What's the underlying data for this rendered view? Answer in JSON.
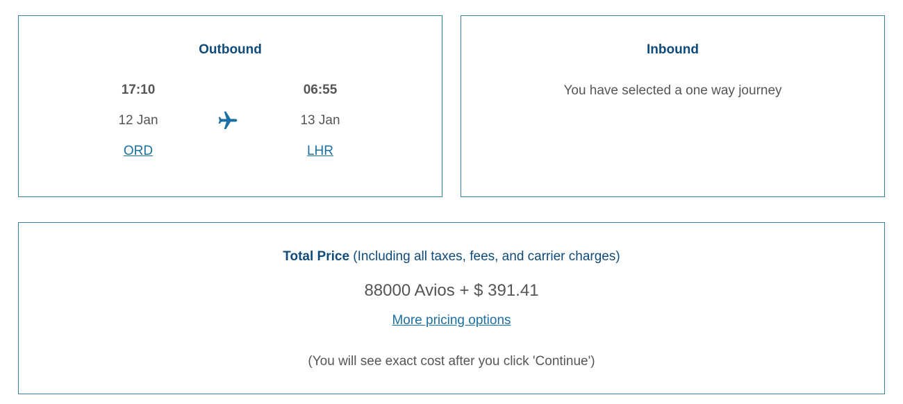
{
  "outbound": {
    "title": "Outbound",
    "departure": {
      "time": "17:10",
      "date": "12 Jan",
      "airport": "ORD"
    },
    "arrival": {
      "time": "06:55",
      "date": "13 Jan",
      "airport": "LHR"
    },
    "icon": "airplane-icon"
  },
  "inbound": {
    "title": "Inbound",
    "message": "You have selected a one way journey"
  },
  "price": {
    "label": "Total Price",
    "note_inline": "(Including all taxes, fees, and carrier charges)",
    "amount": "88000 Avios + $ 391.41",
    "more_link": "More pricing options",
    "footnote": "(You will see exact cost after you click 'Continue')"
  },
  "colors": {
    "title": "#0e4a7a",
    "link": "#1a6fa3",
    "border": "#3a7fa6",
    "text": "#555555",
    "icon": "#1a6fa3"
  }
}
